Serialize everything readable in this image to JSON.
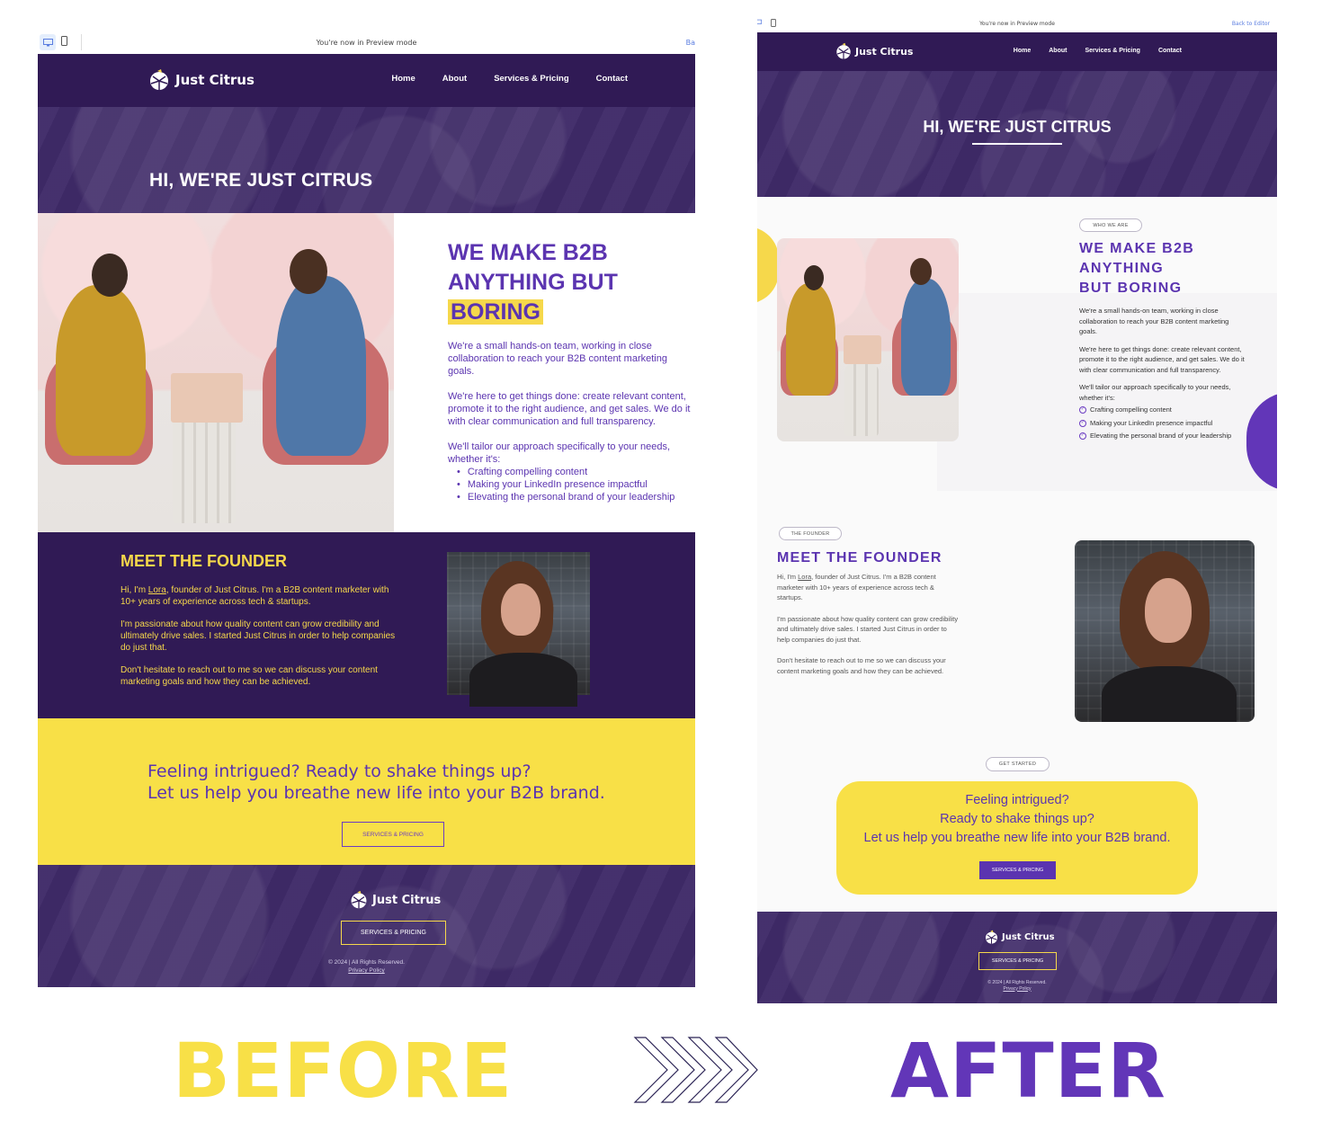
{
  "colors": {
    "purple_dark": "#301a55",
    "purple_accent": "#5b34b0",
    "yellow": "#f6d84b"
  },
  "before": {
    "preview": {
      "notice": "You're now in Preview mode",
      "back_link": "Ba"
    },
    "header": {
      "brand": "Just Citrus",
      "nav": [
        "Home",
        "About",
        "Services & Pricing",
        "Contact"
      ]
    },
    "hero": {
      "title": "HI, WE'RE JUST CITRUS"
    },
    "about": {
      "heading_line1": "WE MAKE B2B",
      "heading_line2": "ANYTHING BUT",
      "heading_highlight": "BORING",
      "p1": "We're a small hands-on team, working in close collaboration to reach your B2B content marketing goals.",
      "p2": "We're here to get things done: create relevant content, promote it to the right audience, and get sales. We do it with clear communication and full transparency.",
      "p3": "We'll tailor our approach specifically to your needs, whether it's:",
      "list": [
        "Crafting compelling content",
        "Making your LinkedIn presence impactful",
        "Elevating the personal brand of your leadership"
      ]
    },
    "founder": {
      "heading": "MEET THE FOUNDER",
      "p1_prefix": "Hi, I'm ",
      "p1_name": "Lora",
      "p1_suffix": ", founder of Just Citrus. I'm a B2B content marketer with 10+ years of experience across tech & startups.",
      "p2": "I'm passionate about how quality content can grow credibility and ultimately drive sales. I started Just Citrus in order to help companies do just that.",
      "p3": "Don't hesitate to reach out to me so we can discuss your content marketing goals and how they can be achieved."
    },
    "cta": {
      "line1": "Feeling intrigued? Ready to shake things up?",
      "line2": "Let us help you breathe new life into your B2B brand.",
      "button": "SERVICES & PRICING"
    },
    "footer": {
      "brand": "Just Citrus",
      "button": "SERVICES & PRICING",
      "copyright": "© 2024 | All Rights Reserved.",
      "privacy": "Privacy Policy"
    }
  },
  "after": {
    "preview": {
      "notice": "You're now in Preview mode",
      "back_link": "Back to Editor"
    },
    "header": {
      "brand": "Just Citrus",
      "nav": [
        "Home",
        "About",
        "Services & Pricing",
        "Contact"
      ]
    },
    "hero": {
      "title": "HI, WE'RE JUST CITRUS"
    },
    "about": {
      "pill": "WHO WE ARE",
      "heading_line1": "WE MAKE B2B",
      "heading_line2": "ANYTHING",
      "heading_line3": "BUT BORING",
      "p1": "We're a small hands-on team, working in close collaboration to reach your B2B content marketing goals.",
      "p2": "We're here to get things done: create relevant content, promote it to the right audience, and get sales. We do it with clear communication and full transparency.",
      "p3": "We'll tailor our approach specifically to your needs, whether it's:",
      "list": [
        "Crafting compelling content",
        "Making your LinkedIn presence impactful",
        "Elevating the personal brand of your leadership"
      ]
    },
    "founder": {
      "pill": "THE FOUNDER",
      "heading": "MEET THE FOUNDER",
      "p1_prefix": "Hi, I'm ",
      "p1_name": "Lora",
      "p1_suffix": ", founder of Just Citrus. I'm a B2B content marketer with 10+ years of experience across tech & startups.",
      "p2": "I'm passionate about how quality content can grow credibility and ultimately drive sales. I started Just Citrus in order to help companies do just that.",
      "p3": "Don't hesitate to reach out to me so we can discuss your content marketing goals and how they can be achieved."
    },
    "cta": {
      "pill": "GET STARTED",
      "line1": "Feeling intrigued?",
      "line2": "Ready to shake things up?",
      "line3": "Let us help you breathe new life into your B2B brand.",
      "button": "SERVICES & PRICING"
    },
    "footer": {
      "brand": "Just Citrus",
      "button": "SERVICES & PRICING",
      "copyright": "© 2024 | All Rights Reserved.",
      "privacy": "Privacy Policy"
    }
  },
  "labels": {
    "before": "BEFORE",
    "after": "AFTER"
  },
  "icons": {
    "desktop": "desktop-icon",
    "mobile": "mobile-icon",
    "logo": "citrus-logo-icon",
    "check": "check-circle-icon",
    "arrows": "chevron-right-arrows-icon"
  }
}
